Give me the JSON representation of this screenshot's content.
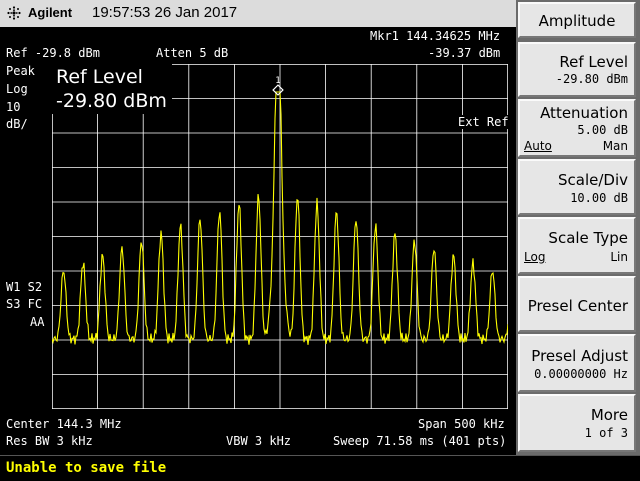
{
  "titlebar": {
    "brand": "Agilent",
    "datetime": "19:57:53  26 Jan 2017"
  },
  "screen": {
    "marker_readout": "Mkr1  144.34625 MHz",
    "ref_readout": "Ref -29.8 dBm",
    "atten_readout": "Atten 5 dB",
    "marker_amplitude": "-39.37 dBm",
    "detector": "Peak",
    "scale_type": "Log",
    "scale_value": "10",
    "scale_unit": "dB/",
    "active_function_name": "Ref Level",
    "active_function_value": "-29.80 dBm",
    "ext_ref": "Ext Ref",
    "trace_flags_line1": "W1  S2",
    "trace_flags_line2": "S3  FC",
    "trace_flags_line3": "AA",
    "marker_label": "1",
    "center": "Center 144.3 MHz",
    "span": "Span 500 kHz",
    "res_bw": "Res BW 3 kHz",
    "vbw": "VBW 3 kHz",
    "sweep": "Sweep 71.58 ms (401 pts)"
  },
  "status_message": "Unable to save file",
  "softkeys": {
    "menu_title": "Amplitude",
    "ref_level_label": "Ref Level",
    "ref_level_value": "-29.80 dBm",
    "attenuation_label": "Attenuation",
    "attenuation_value": "5.00 dB",
    "attenuation_opt_left": "Auto",
    "attenuation_opt_right": "Man",
    "scale_div_label": "Scale/Div",
    "scale_div_value": "10.00 dB",
    "scale_type_label": "Scale Type",
    "scale_type_opt_left": "Log",
    "scale_type_opt_right": "Lin",
    "presel_center_label": "Presel Center",
    "presel_adjust_label": "Presel Adjust",
    "presel_adjust_value": "0.00000000  Hz",
    "more_label": "More",
    "more_page": "1 of 3"
  },
  "colors": {
    "trace": "#ffff00",
    "grid": "#ffffff",
    "background": "#000000",
    "status_text": "#ffff00",
    "softkey_face": "#e6e6e6"
  }
}
